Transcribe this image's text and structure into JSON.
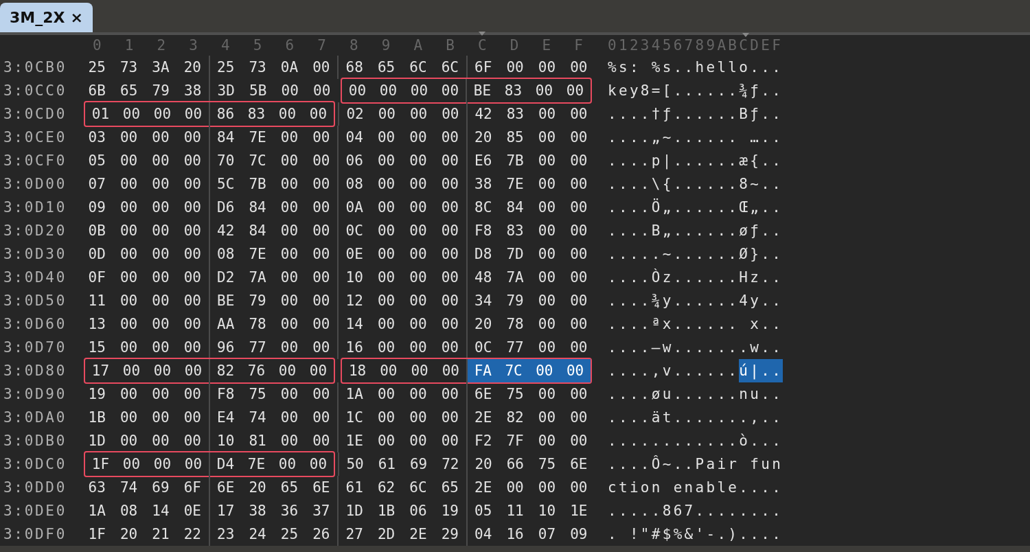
{
  "tabs": [
    {
      "label": "3M_2X",
      "close": "×",
      "selected": true
    }
  ],
  "columns": [
    {
      "label": "0",
      "marked": false
    },
    {
      "label": "1",
      "marked": false
    },
    {
      "label": "2",
      "marked": false
    },
    {
      "label": "3",
      "marked": false
    },
    {
      "label": "4",
      "marked": false
    },
    {
      "label": "5",
      "marked": false
    },
    {
      "label": "6",
      "marked": false
    },
    {
      "label": "7",
      "marked": false
    },
    {
      "label": "8",
      "marked": false
    },
    {
      "label": "9",
      "marked": false
    },
    {
      "label": "A",
      "marked": false
    },
    {
      "label": "B",
      "marked": false
    },
    {
      "label": "C",
      "marked": true
    },
    {
      "label": "D",
      "marked": false
    },
    {
      "label": "E",
      "marked": false
    },
    {
      "label": "F",
      "marked": false
    }
  ],
  "ascii_header": "0123456789ABCDEF",
  "rows": [
    {
      "address": "3:0CB0",
      "segments": [
        {
          "boxed": false,
          "runs": [
            {
              "selected": false,
              "bytes": [
                "25",
                "73",
                "3A",
                "20",
                "25",
                "73",
                "0A",
                "00",
                "68",
                "65",
                "6C",
                "6C",
                "6F",
                "00",
                "00",
                "00"
              ]
            }
          ]
        }
      ],
      "ascii": [
        {
          "text": "%s: %s..hello...",
          "selected": false
        }
      ]
    },
    {
      "address": "3:0CC0",
      "segments": [
        {
          "boxed": false,
          "runs": [
            {
              "selected": false,
              "bytes": [
                "6B",
                "65",
                "79",
                "38",
                "3D",
                "5B",
                "00",
                "00"
              ]
            }
          ]
        },
        {
          "boxed": true,
          "runs": [
            {
              "selected": false,
              "bytes": [
                "00",
                "00",
                "00",
                "00",
                "BE",
                "83",
                "00",
                "00"
              ]
            }
          ]
        }
      ],
      "ascii": [
        {
          "text": "key8=[......¾ƒ..",
          "selected": false
        }
      ]
    },
    {
      "address": "3:0CD0",
      "segments": [
        {
          "boxed": true,
          "runs": [
            {
              "selected": false,
              "bytes": [
                "01",
                "00",
                "00",
                "00",
                "86",
                "83",
                "00",
                "00"
              ]
            }
          ]
        },
        {
          "boxed": false,
          "runs": [
            {
              "selected": false,
              "bytes": [
                "02",
                "00",
                "00",
                "00",
                "42",
                "83",
                "00",
                "00"
              ]
            }
          ]
        }
      ],
      "ascii": [
        {
          "text": "....†ƒ......Bƒ..",
          "selected": false
        }
      ]
    },
    {
      "address": "3:0CE0",
      "segments": [
        {
          "boxed": false,
          "runs": [
            {
              "selected": false,
              "bytes": [
                "03",
                "00",
                "00",
                "00",
                "84",
                "7E",
                "00",
                "00",
                "04",
                "00",
                "00",
                "00",
                "20",
                "85",
                "00",
                "00"
              ]
            }
          ]
        }
      ],
      "ascii": [
        {
          "text": "....„~...... …..",
          "selected": false
        }
      ]
    },
    {
      "address": "3:0CF0",
      "segments": [
        {
          "boxed": false,
          "runs": [
            {
              "selected": false,
              "bytes": [
                "05",
                "00",
                "00",
                "00",
                "70",
                "7C",
                "00",
                "00",
                "06",
                "00",
                "00",
                "00",
                "E6",
                "7B",
                "00",
                "00"
              ]
            }
          ]
        }
      ],
      "ascii": [
        {
          "text": "....p|......æ{..",
          "selected": false
        }
      ]
    },
    {
      "address": "3:0D00",
      "segments": [
        {
          "boxed": false,
          "runs": [
            {
              "selected": false,
              "bytes": [
                "07",
                "00",
                "00",
                "00",
                "5C",
                "7B",
                "00",
                "00",
                "08",
                "00",
                "00",
                "00",
                "38",
                "7E",
                "00",
                "00"
              ]
            }
          ]
        }
      ],
      "ascii": [
        {
          "text": "....\\{......8~..",
          "selected": false
        }
      ]
    },
    {
      "address": "3:0D10",
      "segments": [
        {
          "boxed": false,
          "runs": [
            {
              "selected": false,
              "bytes": [
                "09",
                "00",
                "00",
                "00",
                "D6",
                "84",
                "00",
                "00",
                "0A",
                "00",
                "00",
                "00",
                "8C",
                "84",
                "00",
                "00"
              ]
            }
          ]
        }
      ],
      "ascii": [
        {
          "text": "....Ö„......Œ„..",
          "selected": false
        }
      ]
    },
    {
      "address": "3:0D20",
      "segments": [
        {
          "boxed": false,
          "runs": [
            {
              "selected": false,
              "bytes": [
                "0B",
                "00",
                "00",
                "00",
                "42",
                "84",
                "00",
                "00",
                "0C",
                "00",
                "00",
                "00",
                "F8",
                "83",
                "00",
                "00"
              ]
            }
          ]
        }
      ],
      "ascii": [
        {
          "text": "....B„......øƒ..",
          "selected": false
        }
      ]
    },
    {
      "address": "3:0D30",
      "segments": [
        {
          "boxed": false,
          "runs": [
            {
              "selected": false,
              "bytes": [
                "0D",
                "00",
                "00",
                "00",
                "08",
                "7E",
                "00",
                "00",
                "0E",
                "00",
                "00",
                "00",
                "D8",
                "7D",
                "00",
                "00"
              ]
            }
          ]
        }
      ],
      "ascii": [
        {
          "text": ".....~......Ø}..",
          "selected": false
        }
      ]
    },
    {
      "address": "3:0D40",
      "segments": [
        {
          "boxed": false,
          "runs": [
            {
              "selected": false,
              "bytes": [
                "0F",
                "00",
                "00",
                "00",
                "D2",
                "7A",
                "00",
                "00",
                "10",
                "00",
                "00",
                "00",
                "48",
                "7A",
                "00",
                "00"
              ]
            }
          ]
        }
      ],
      "ascii": [
        {
          "text": "....Òz......Hz..",
          "selected": false
        }
      ]
    },
    {
      "address": "3:0D50",
      "segments": [
        {
          "boxed": false,
          "runs": [
            {
              "selected": false,
              "bytes": [
                "11",
                "00",
                "00",
                "00",
                "BE",
                "79",
                "00",
                "00",
                "12",
                "00",
                "00",
                "00",
                "34",
                "79",
                "00",
                "00"
              ]
            }
          ]
        }
      ],
      "ascii": [
        {
          "text": "....¾y......4y..",
          "selected": false
        }
      ]
    },
    {
      "address": "3:0D60",
      "segments": [
        {
          "boxed": false,
          "runs": [
            {
              "selected": false,
              "bytes": [
                "13",
                "00",
                "00",
                "00",
                "AA",
                "78",
                "00",
                "00",
                "14",
                "00",
                "00",
                "00",
                "20",
                "78",
                "00",
                "00"
              ]
            }
          ]
        }
      ],
      "ascii": [
        {
          "text": "....ªx...... x..",
          "selected": false
        }
      ]
    },
    {
      "address": "3:0D70",
      "segments": [
        {
          "boxed": false,
          "runs": [
            {
              "selected": false,
              "bytes": [
                "15",
                "00",
                "00",
                "00",
                "96",
                "77",
                "00",
                "00",
                "16",
                "00",
                "00",
                "00",
                "0C",
                "77",
                "00",
                "00"
              ]
            }
          ]
        }
      ],
      "ascii": [
        {
          "text": "....–w.......w..",
          "selected": false
        }
      ]
    },
    {
      "address": "3:0D80",
      "segments": [
        {
          "boxed": true,
          "runs": [
            {
              "selected": false,
              "bytes": [
                "17",
                "00",
                "00",
                "00",
                "82",
                "76",
                "00",
                "00"
              ]
            }
          ]
        },
        {
          "boxed": true,
          "runs": [
            {
              "selected": false,
              "bytes": [
                "18",
                "00",
                "00",
                "00"
              ]
            },
            {
              "selected": true,
              "bytes": [
                "FA",
                "7C",
                "00",
                "00"
              ]
            }
          ]
        }
      ],
      "ascii": [
        {
          "text": "....‚v......",
          "selected": false
        },
        {
          "text": "ú|..",
          "selected": true
        }
      ]
    },
    {
      "address": "3:0D90",
      "segments": [
        {
          "boxed": false,
          "runs": [
            {
              "selected": false,
              "bytes": [
                "19",
                "00",
                "00",
                "00",
                "F8",
                "75",
                "00",
                "00",
                "1A",
                "00",
                "00",
                "00",
                "6E",
                "75",
                "00",
                "00"
              ]
            }
          ]
        }
      ],
      "ascii": [
        {
          "text": "....øu......nu..",
          "selected": false
        }
      ]
    },
    {
      "address": "3:0DA0",
      "segments": [
        {
          "boxed": false,
          "runs": [
            {
              "selected": false,
              "bytes": [
                "1B",
                "00",
                "00",
                "00",
                "E4",
                "74",
                "00",
                "00",
                "1C",
                "00",
                "00",
                "00",
                "2E",
                "82",
                "00",
                "00"
              ]
            }
          ]
        }
      ],
      "ascii": [
        {
          "text": "....ät.......‚..",
          "selected": false
        }
      ]
    },
    {
      "address": "3:0DB0",
      "segments": [
        {
          "boxed": false,
          "runs": [
            {
              "selected": false,
              "bytes": [
                "1D",
                "00",
                "00",
                "00",
                "10",
                "81",
                "00",
                "00",
                "1E",
                "00",
                "00",
                "00",
                "F2",
                "7F",
                "00",
                "00"
              ]
            }
          ]
        }
      ],
      "ascii": [
        {
          "text": "............ò...",
          "selected": false
        }
      ]
    },
    {
      "address": "3:0DC0",
      "segments": [
        {
          "boxed": true,
          "runs": [
            {
              "selected": false,
              "bytes": [
                "1F",
                "00",
                "00",
                "00",
                "D4",
                "7E",
                "00",
                "00"
              ]
            }
          ]
        },
        {
          "boxed": false,
          "runs": [
            {
              "selected": false,
              "bytes": [
                "50",
                "61",
                "69",
                "72",
                "20",
                "66",
                "75",
                "6E"
              ]
            }
          ]
        }
      ],
      "ascii": [
        {
          "text": "....Ô~..Pair fun",
          "selected": false
        }
      ]
    },
    {
      "address": "3:0DD0",
      "segments": [
        {
          "boxed": false,
          "runs": [
            {
              "selected": false,
              "bytes": [
                "63",
                "74",
                "69",
                "6F",
                "6E",
                "20",
                "65",
                "6E",
                "61",
                "62",
                "6C",
                "65",
                "2E",
                "00",
                "00",
                "00"
              ]
            }
          ]
        }
      ],
      "ascii": [
        {
          "text": "ction enable....",
          "selected": false
        }
      ]
    },
    {
      "address": "3:0DE0",
      "segments": [
        {
          "boxed": false,
          "runs": [
            {
              "selected": false,
              "bytes": [
                "1A",
                "08",
                "14",
                "0E",
                "17",
                "38",
                "36",
                "37",
                "1D",
                "1B",
                "06",
                "19",
                "05",
                "11",
                "10",
                "1E"
              ]
            }
          ]
        }
      ],
      "ascii": [
        {
          "text": ".....867........",
          "selected": false
        }
      ]
    },
    {
      "address": "3:0DF0",
      "segments": [
        {
          "boxed": false,
          "runs": [
            {
              "selected": false,
              "bytes": [
                "1F",
                "20",
                "21",
                "22",
                "23",
                "24",
                "25",
                "26",
                "27",
                "2D",
                "2E",
                "29",
                "04",
                "16",
                "07",
                "09"
              ]
            }
          ]
        }
      ],
      "ascii": [
        {
          "text": ". !\"#$%&'-.)....",
          "selected": false
        }
      ]
    }
  ]
}
